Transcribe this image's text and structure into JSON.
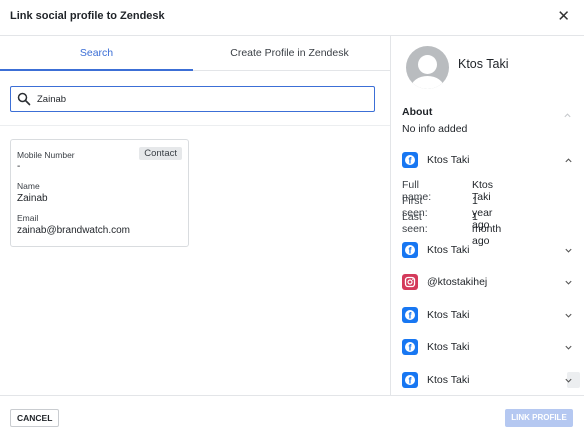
{
  "dialog": {
    "title": "Link social profile to Zendesk",
    "close_icon": "close-icon"
  },
  "tabs": [
    {
      "label": "Search",
      "active": true
    },
    {
      "label": "Create Profile in Zendesk",
      "active": false
    }
  ],
  "search": {
    "value": "Zainab",
    "icon": "search-icon"
  },
  "contact_card": {
    "badge": "Contact",
    "fields": [
      {
        "label": "Mobile Number",
        "value": "-"
      },
      {
        "label": "Name",
        "value": "Zainab"
      },
      {
        "label": "Email",
        "value": "zainab@brandwatch.com"
      }
    ]
  },
  "profile": {
    "name": "Ktos Taki",
    "about_title": "About",
    "about_text": "No info added",
    "networks": [
      {
        "network": "facebook",
        "icon": "facebook-icon",
        "name": "Ktos Taki",
        "expanded": true,
        "details": [
          {
            "key": "Full name:",
            "value": "Ktos Taki"
          },
          {
            "key": "First seen:",
            "value": "1 year ago"
          },
          {
            "key": "Last seen:",
            "value": "1 month ago"
          }
        ]
      },
      {
        "network": "facebook",
        "icon": "facebook-icon",
        "name": "Ktos Taki",
        "expanded": false
      },
      {
        "network": "instagram",
        "icon": "instagram-icon",
        "name": "@ktostakihej",
        "expanded": false
      },
      {
        "network": "facebook",
        "icon": "facebook-icon",
        "name": "Ktos Taki",
        "expanded": false
      },
      {
        "network": "facebook",
        "icon": "facebook-icon",
        "name": "Ktos Taki",
        "expanded": false
      },
      {
        "network": "facebook",
        "icon": "facebook-icon",
        "name": "Ktos Taki",
        "expanded": false
      }
    ]
  },
  "footer": {
    "cancel_label": "CANCEL",
    "link_label": "LINK PROFILE",
    "link_enabled": false
  },
  "colors": {
    "accent": "#3c6fd6",
    "facebook": "#1877f2",
    "instagram": "#d43a5b",
    "disabled_button": "#b5c8f1"
  }
}
